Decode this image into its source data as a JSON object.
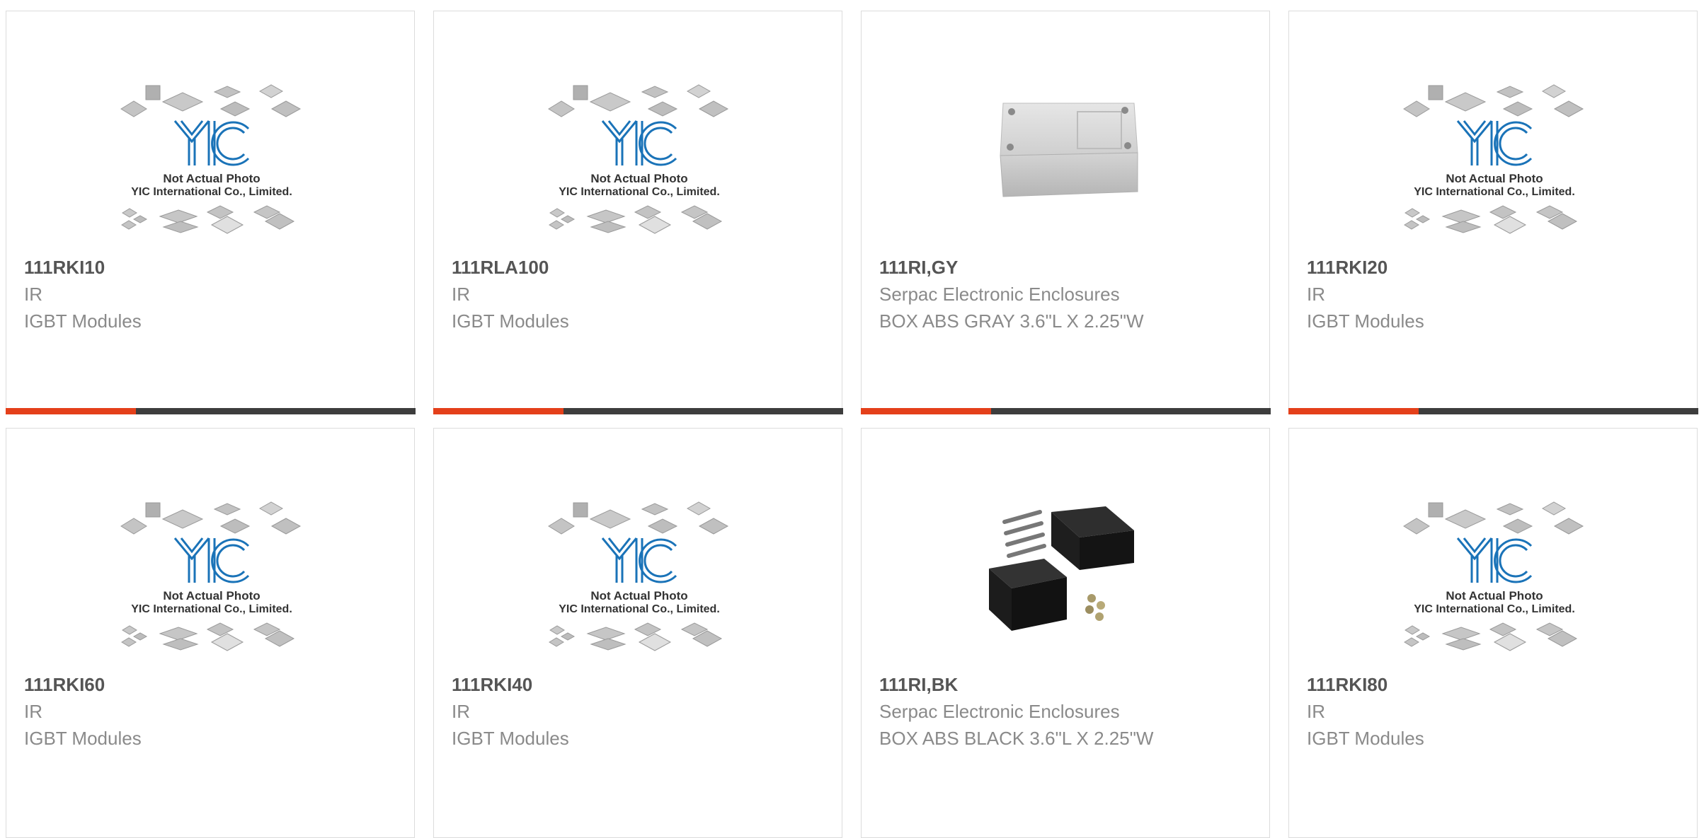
{
  "colors": {
    "accent": "#e4401a",
    "bar": "#3d3d3d",
    "logo": "#1a73b8"
  },
  "placeholder": {
    "line1": "Not Actual Photo",
    "line2": "YIC International Co., Limited."
  },
  "products": [
    {
      "part": "111RKI10",
      "mfr": "IR",
      "desc": "IGBT Modules",
      "image": "yic-placeholder"
    },
    {
      "part": "111RLA100",
      "mfr": "IR",
      "desc": "IGBT Modules",
      "image": "yic-placeholder"
    },
    {
      "part": "111RI,GY",
      "mfr": "Serpac Electronic Enclosures",
      "desc": "BOX ABS GRAY 3.6\"L X 2.25\"W",
      "image": "gray-enclosure"
    },
    {
      "part": "111RKI20",
      "mfr": "IR",
      "desc": "IGBT Modules",
      "image": "yic-placeholder"
    },
    {
      "part": "111RKI60",
      "mfr": "IR",
      "desc": "IGBT Modules",
      "image": "yic-placeholder"
    },
    {
      "part": "111RKI40",
      "mfr": "IR",
      "desc": "IGBT Modules",
      "image": "yic-placeholder"
    },
    {
      "part": "111RI,BK",
      "mfr": "Serpac Electronic Enclosures",
      "desc": "BOX ABS BLACK 3.6\"L X 2.25\"W",
      "image": "black-enclosure"
    },
    {
      "part": "111RKI80",
      "mfr": "IR",
      "desc": "IGBT Modules",
      "image": "yic-placeholder"
    }
  ]
}
